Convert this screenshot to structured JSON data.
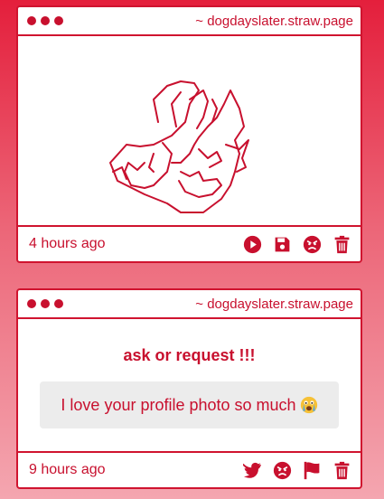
{
  "cards": [
    {
      "url": "~ dogdayslater.straw.page",
      "time": "4 hours ago",
      "actions": [
        "play-icon",
        "save-icon",
        "angry-face-icon",
        "trash-icon"
      ]
    },
    {
      "url": "~ dogdayslater.straw.page",
      "question": "ask or request !!!",
      "answer": "I love your profile photo so much",
      "answer_emoji": "crying-face-icon",
      "time": "9 hours ago",
      "actions": [
        "twitter-icon",
        "angry-face-icon",
        "flag-icon",
        "trash-icon"
      ]
    }
  ],
  "colors": {
    "accent": "#c8102e",
    "border": "#d0142f",
    "answer_bg": "#ececec"
  }
}
